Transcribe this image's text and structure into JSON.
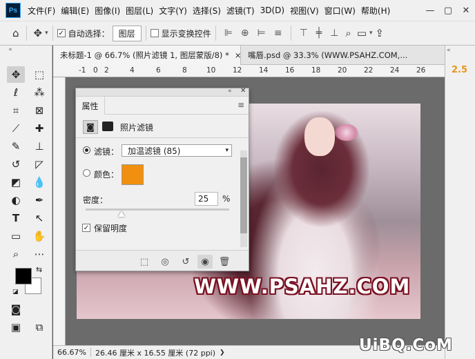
{
  "app": {
    "logo": "Ps"
  },
  "menubar": {
    "items": [
      "文件(F)",
      "编辑(E)",
      "图像(I)",
      "图层(L)",
      "文字(Y)",
      "选择(S)",
      "滤镜(T)",
      "3D(D)",
      "视图(V)",
      "窗口(W)",
      "帮助(H)"
    ],
    "window_controls": [
      "—",
      "▢",
      "✕"
    ]
  },
  "options_bar": {
    "auto_select_label": "自动选择：",
    "auto_select_checked": "✓",
    "layer_select_value": "图层",
    "show_transform_label": "显示变换控件"
  },
  "tabs": [
    {
      "label": "未标题-1 @ 66.7% (照片滤镜 1, 图层蒙版/8) *",
      "close": "×"
    },
    {
      "label": "嘴唇.psd @ 33.3% (WWW.PSAHZ.COM,...",
      "close": ""
    }
  ],
  "ruler": {
    "ticks": [
      "-1",
      "0",
      "2",
      "4",
      "6",
      "8",
      "10",
      "12",
      "14",
      "16",
      "18",
      "20",
      "22",
      "24",
      "26"
    ]
  },
  "right_strip": {
    "value": "2.5"
  },
  "properties_panel": {
    "tab_label": "属性",
    "type_label": "照片滤镜",
    "filter_label": "滤镜：",
    "filter_value": "加温滤镜 (85)",
    "color_label": "颜色：",
    "color_value": "#f0900e",
    "density_label": "密度：",
    "density_value": "25",
    "density_unit": "%",
    "density_fraction": 0.25,
    "preserve_label": "保留明度",
    "preserve_checked": "✓"
  },
  "canvas": {
    "watermark": "WWW.PSAHZ.COM"
  },
  "status_bar": {
    "zoom": "66.67%",
    "doc_info": "26.46 厘米 x 16.55 厘米 (72 ppi)"
  },
  "site_watermark": "UiBQ.CoM"
}
